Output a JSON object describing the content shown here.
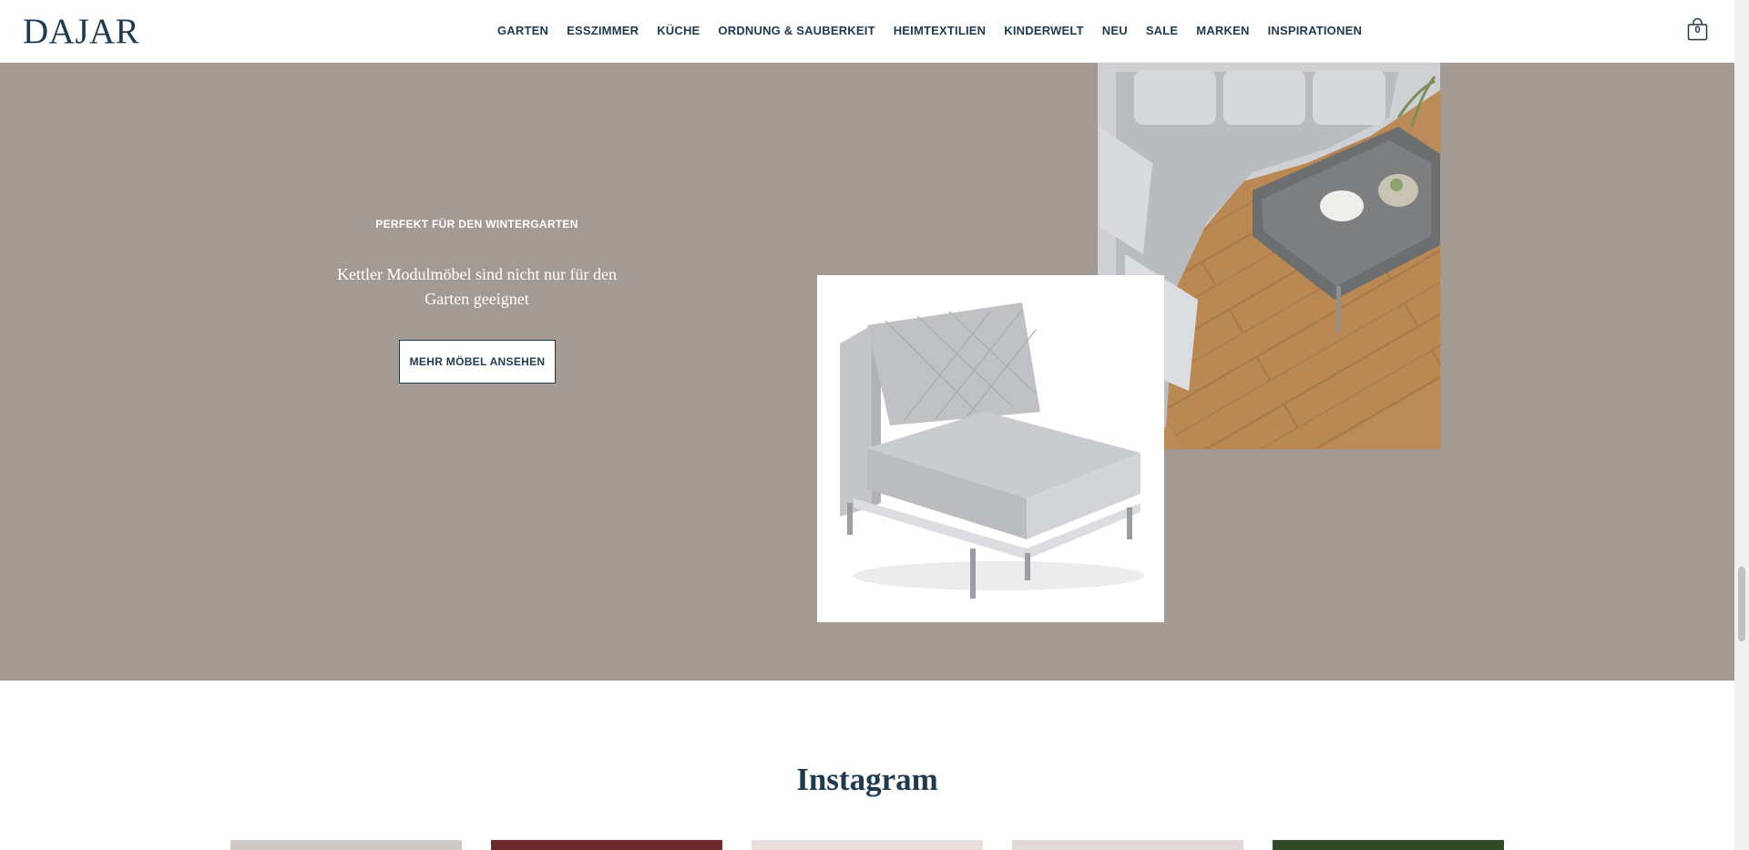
{
  "header": {
    "logo": "DAJAR",
    "nav": [
      {
        "label": "GARTEN"
      },
      {
        "label": "ESSZIMMER"
      },
      {
        "label": "KÜCHE"
      },
      {
        "label": "ORDNUNG & SAUBERKEIT"
      },
      {
        "label": "HEIMTEXTILIEN"
      },
      {
        "label": "KINDERWELT"
      },
      {
        "label": "NEU"
      },
      {
        "label": "SALE"
      },
      {
        "label": "MARKEN"
      },
      {
        "label": "INSPIRATIONEN"
      }
    ],
    "cart_icon": "shopping-bag-icon",
    "cart_count": "0"
  },
  "hero": {
    "eyebrow": "PERFEKT FÜR DEN WINTERGARTEN",
    "headline": "Kettler Modulmöbel sind nicht nur für den Garten geeignet",
    "cta_label": "MEHR MÖBEL ANSEHEN",
    "background_color": "#a39a94"
  },
  "instagram": {
    "title": "Instagram",
    "tile_colors": [
      "#cfcac6",
      "#6b2a2c",
      "#e8dfdc",
      "#e0d9d8",
      "#2f4a24"
    ]
  },
  "colors": {
    "brand": "#1f3a4d",
    "hero_bg": "#a39a94"
  }
}
